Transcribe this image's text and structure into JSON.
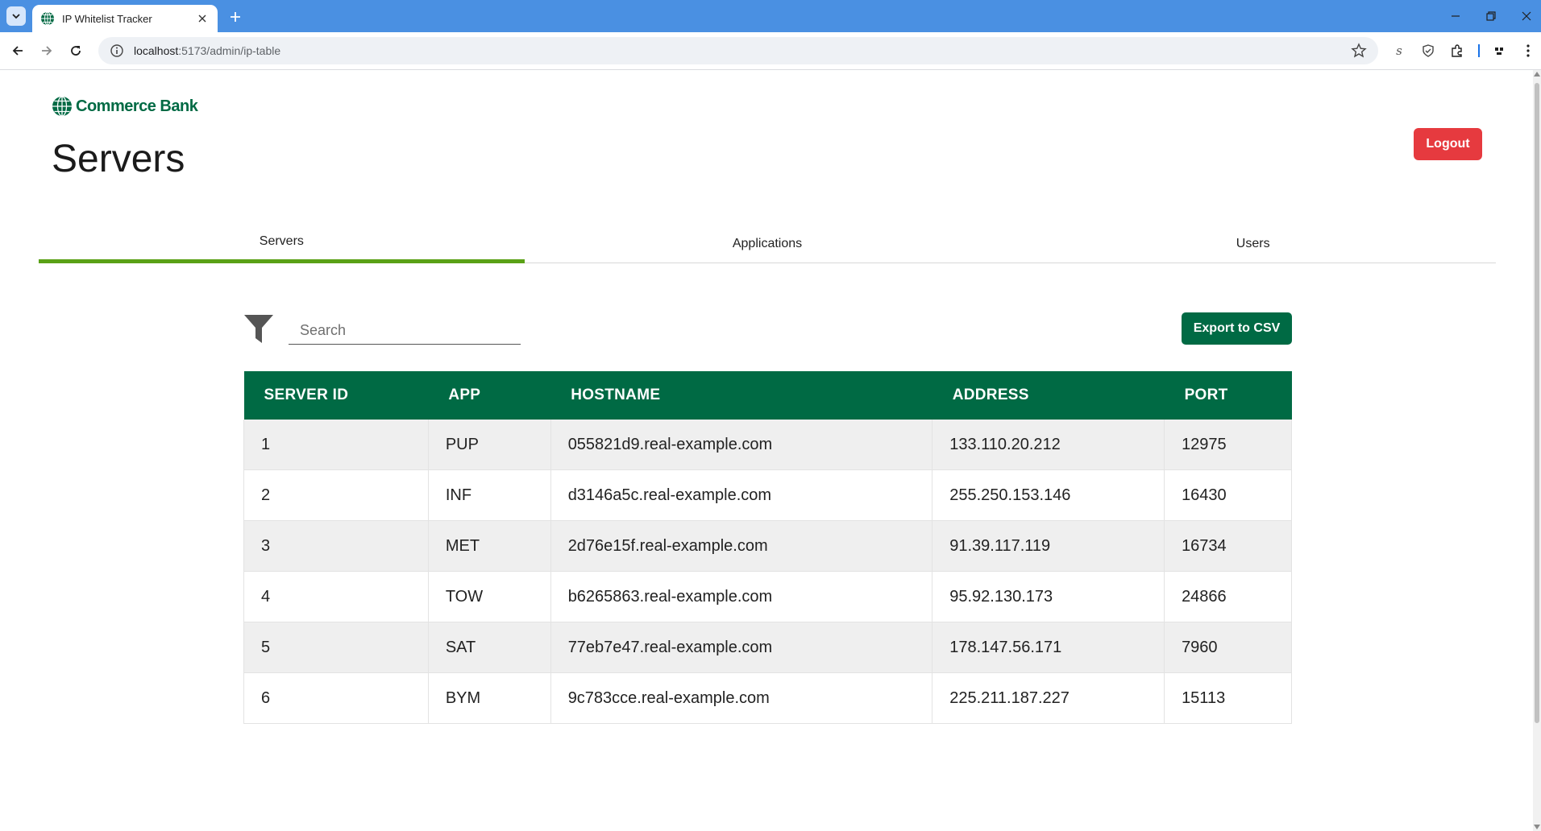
{
  "browser": {
    "tab_title": "IP Whitelist Tracker",
    "url_host": "localhost",
    "url_rest": ":5173/admin/ip-table"
  },
  "brand": {
    "logo_text": "Commerce Bank",
    "primary_color": "#006a44",
    "accent_color": "#5aa116",
    "danger_color": "#e63a3f"
  },
  "header": {
    "title": "Servers",
    "logout_label": "Logout"
  },
  "tabs": [
    {
      "label": "Servers",
      "active": true
    },
    {
      "label": "Applications",
      "active": false
    },
    {
      "label": "Users",
      "active": false
    }
  ],
  "toolbar": {
    "search_placeholder": "Search",
    "search_value": "",
    "export_label": "Export to CSV"
  },
  "table": {
    "columns": [
      "SERVER ID",
      "APP",
      "HOSTNAME",
      "ADDRESS",
      "PORT"
    ],
    "rows": [
      [
        "1",
        "PUP",
        "055821d9.real-example.com",
        "133.110.20.212",
        "12975"
      ],
      [
        "2",
        "INF",
        "d3146a5c.real-example.com",
        "255.250.153.146",
        "16430"
      ],
      [
        "3",
        "MET",
        "2d76e15f.real-example.com",
        "91.39.117.119",
        "16734"
      ],
      [
        "4",
        "TOW",
        "b6265863.real-example.com",
        "95.92.130.173",
        "24866"
      ],
      [
        "5",
        "SAT",
        "77eb7e47.real-example.com",
        "178.147.56.171",
        "7960"
      ],
      [
        "6",
        "BYM",
        "9c783cce.real-example.com",
        "225.211.187.227",
        "15113"
      ]
    ]
  }
}
